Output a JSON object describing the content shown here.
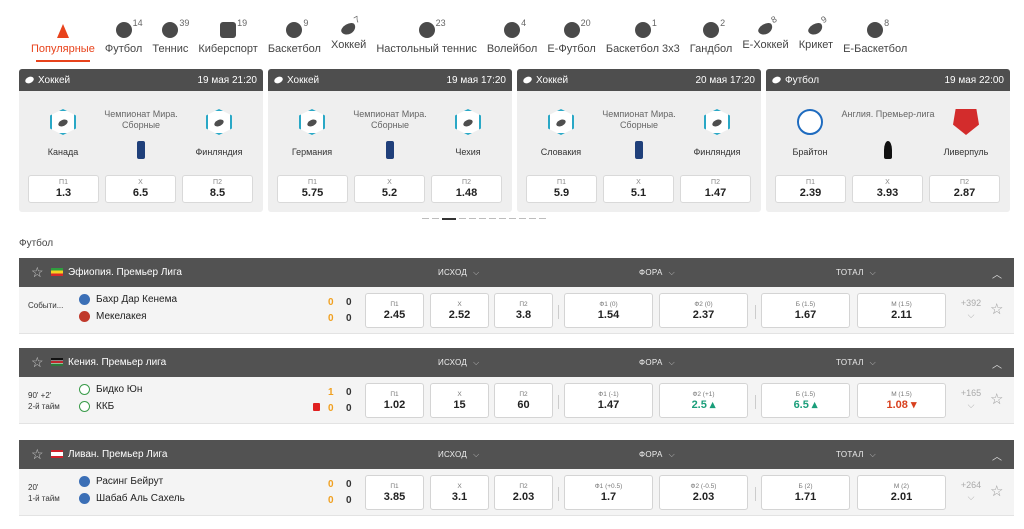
{
  "tabs": [
    {
      "label": "Популярные",
      "count": "",
      "icon": "fire-icon",
      "active": true
    },
    {
      "label": "Футбол",
      "count": "14",
      "icon": "soccer-ball-icon"
    },
    {
      "label": "Теннис",
      "count": "39",
      "icon": "tennis-ball-icon"
    },
    {
      "label": "Киберспорт",
      "count": "19",
      "icon": "gamepad-icon"
    },
    {
      "label": "Баскетбол",
      "count": "9",
      "icon": "basketball-icon"
    },
    {
      "label": "Хоккей",
      "count": "7",
      "icon": "hockey-puck-icon"
    },
    {
      "label": "Настольный теннис",
      "count": "23",
      "icon": "table-tennis-icon"
    },
    {
      "label": "Волейбол",
      "count": "4",
      "icon": "volleyball-icon"
    },
    {
      "label": "Е-Футбол",
      "count": "20",
      "icon": "e-football-icon"
    },
    {
      "label": "Баскетбол 3х3",
      "count": "1",
      "icon": "basketball-3x3-icon"
    },
    {
      "label": "Гандбол",
      "count": "2",
      "icon": "handball-icon"
    },
    {
      "label": "Е-Хоккей",
      "count": "8",
      "icon": "e-hockey-icon"
    },
    {
      "label": "Крикет",
      "count": "9",
      "icon": "cricket-bat-icon"
    },
    {
      "label": "Е-Баскетбол",
      "count": "8",
      "icon": "e-basketball-icon"
    }
  ],
  "cards": [
    {
      "sport": "Хоккей",
      "date": "19 мая 21:20",
      "champ": "Чемпионат Мира. Сборные",
      "home": "Канада",
      "away": "Финляндия",
      "odds": [
        {
          "k": "П1",
          "v": "1.3"
        },
        {
          "k": "X",
          "v": "6.5"
        },
        {
          "k": "П2",
          "v": "8.5"
        }
      ]
    },
    {
      "sport": "Хоккей",
      "date": "19 мая 17:20",
      "champ": "Чемпионат Мира. Сборные",
      "home": "Германия",
      "away": "Чехия",
      "odds": [
        {
          "k": "П1",
          "v": "5.75"
        },
        {
          "k": "X",
          "v": "5.2"
        },
        {
          "k": "П2",
          "v": "1.48"
        }
      ]
    },
    {
      "sport": "Хоккей",
      "date": "20 мая 17:20",
      "champ": "Чемпионат Мира. Сборные",
      "home": "Словакия",
      "away": "Финляндия",
      "odds": [
        {
          "k": "П1",
          "v": "5.9"
        },
        {
          "k": "X",
          "v": "5.1"
        },
        {
          "k": "П2",
          "v": "1.47"
        }
      ]
    },
    {
      "sport": "Футбол",
      "date": "19 мая 22:00",
      "champ": "Англия. Премьер-лига",
      "home": "Брайтон",
      "away": "Ливерпуль",
      "odds": [
        {
          "k": "П1",
          "v": "2.39"
        },
        {
          "k": "X",
          "v": "3.93"
        },
        {
          "k": "П2",
          "v": "2.87"
        }
      ]
    }
  ],
  "section_title": "Футбол",
  "col_headers": {
    "outcome": "ИСХОД",
    "handicap": "ФОРА",
    "total": "ТОТАЛ"
  },
  "leagues": [
    {
      "name": "Эфиопия. Премьер Лига",
      "time": "Событи...",
      "time2": "",
      "home": "Бахр Дар Кенема",
      "away": "Мекелакея",
      "s1": "0",
      "s1b": "0",
      "s2": "0",
      "s2b": "0",
      "more": "+392",
      "odds": [
        {
          "k": "П1",
          "v": "2.45"
        },
        {
          "k": "X",
          "v": "2.52"
        },
        {
          "k": "П2",
          "v": "3.8"
        },
        {
          "k": "Ф1 (0)",
          "v": "1.54"
        },
        {
          "k": "Ф2 (0)",
          "v": "2.37"
        },
        {
          "k": "Б (1.5)",
          "v": "1.67"
        },
        {
          "k": "М (1.5)",
          "v": "2.11"
        }
      ]
    },
    {
      "name": "Кения. Премьер лига",
      "time": "90' +2'",
      "time2": "2-й тайм",
      "home": "Бидко Юн",
      "away": "ККБ",
      "s1": "1",
      "s1b": "0",
      "s2": "0",
      "s2b": "0",
      "more": "+165",
      "odds": [
        {
          "k": "П1",
          "v": "1.02"
        },
        {
          "k": "X",
          "v": "15"
        },
        {
          "k": "П2",
          "v": "60"
        },
        {
          "k": "Ф1 (-1)",
          "v": "1.47"
        },
        {
          "k": "Ф2 (+1)",
          "v": "2.5 ▴"
        },
        {
          "k": "Б (1.5)",
          "v": "6.5 ▴"
        },
        {
          "k": "М (1.5)",
          "v": "1.08 ▾"
        }
      ]
    },
    {
      "name": "Ливан. Премьер Лига",
      "time": "20'",
      "time2": "1-й тайм",
      "home": "Расинг Бейрут",
      "away": "Шабаб Аль Сахель",
      "s1": "0",
      "s1b": "0",
      "s2": "0",
      "s2b": "0",
      "more": "+264",
      "odds": [
        {
          "k": "П1",
          "v": "3.85"
        },
        {
          "k": "X",
          "v": "3.1"
        },
        {
          "k": "П2",
          "v": "2.03"
        },
        {
          "k": "Ф1 (+0.5)",
          "v": "1.7"
        },
        {
          "k": "Ф2 (-0.5)",
          "v": "2.03"
        },
        {
          "k": "Б (2)",
          "v": "1.71"
        },
        {
          "k": "М (2)",
          "v": "2.01"
        }
      ]
    }
  ],
  "colors": {
    "accent": "#e8431c",
    "header": "#525252",
    "up": "#1a9e7a",
    "down": "#d8401e"
  }
}
